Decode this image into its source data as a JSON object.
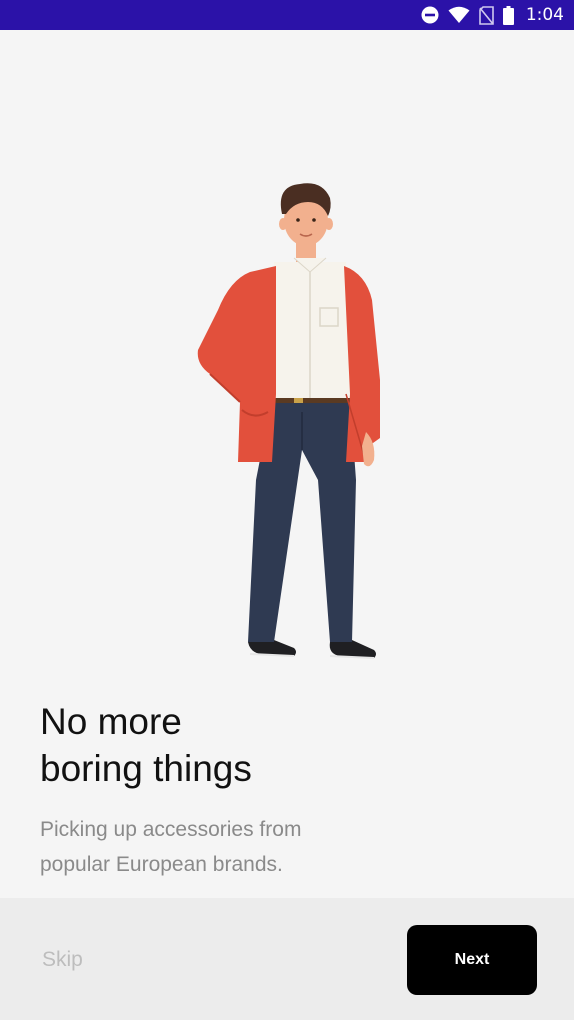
{
  "status_bar": {
    "time": "1:04",
    "icons": [
      "do-not-disturb-icon",
      "wifi-icon",
      "no-sim-icon",
      "battery-icon"
    ],
    "background": "#2b12a8"
  },
  "onboarding": {
    "illustration": "man-in-red-cardigan-illustration",
    "title_line1": "No more",
    "title_line2": "boring things",
    "subtitle_line1": "Picking up accessories from",
    "subtitle_line2": "popular European brands."
  },
  "footer": {
    "skip_label": "Skip",
    "next_label": "Next"
  },
  "colors": {
    "background": "#f5f5f5",
    "footer": "#ececec",
    "primary_button": "#000000",
    "jacket": "#e2503c",
    "pants": "#2f3a52"
  }
}
